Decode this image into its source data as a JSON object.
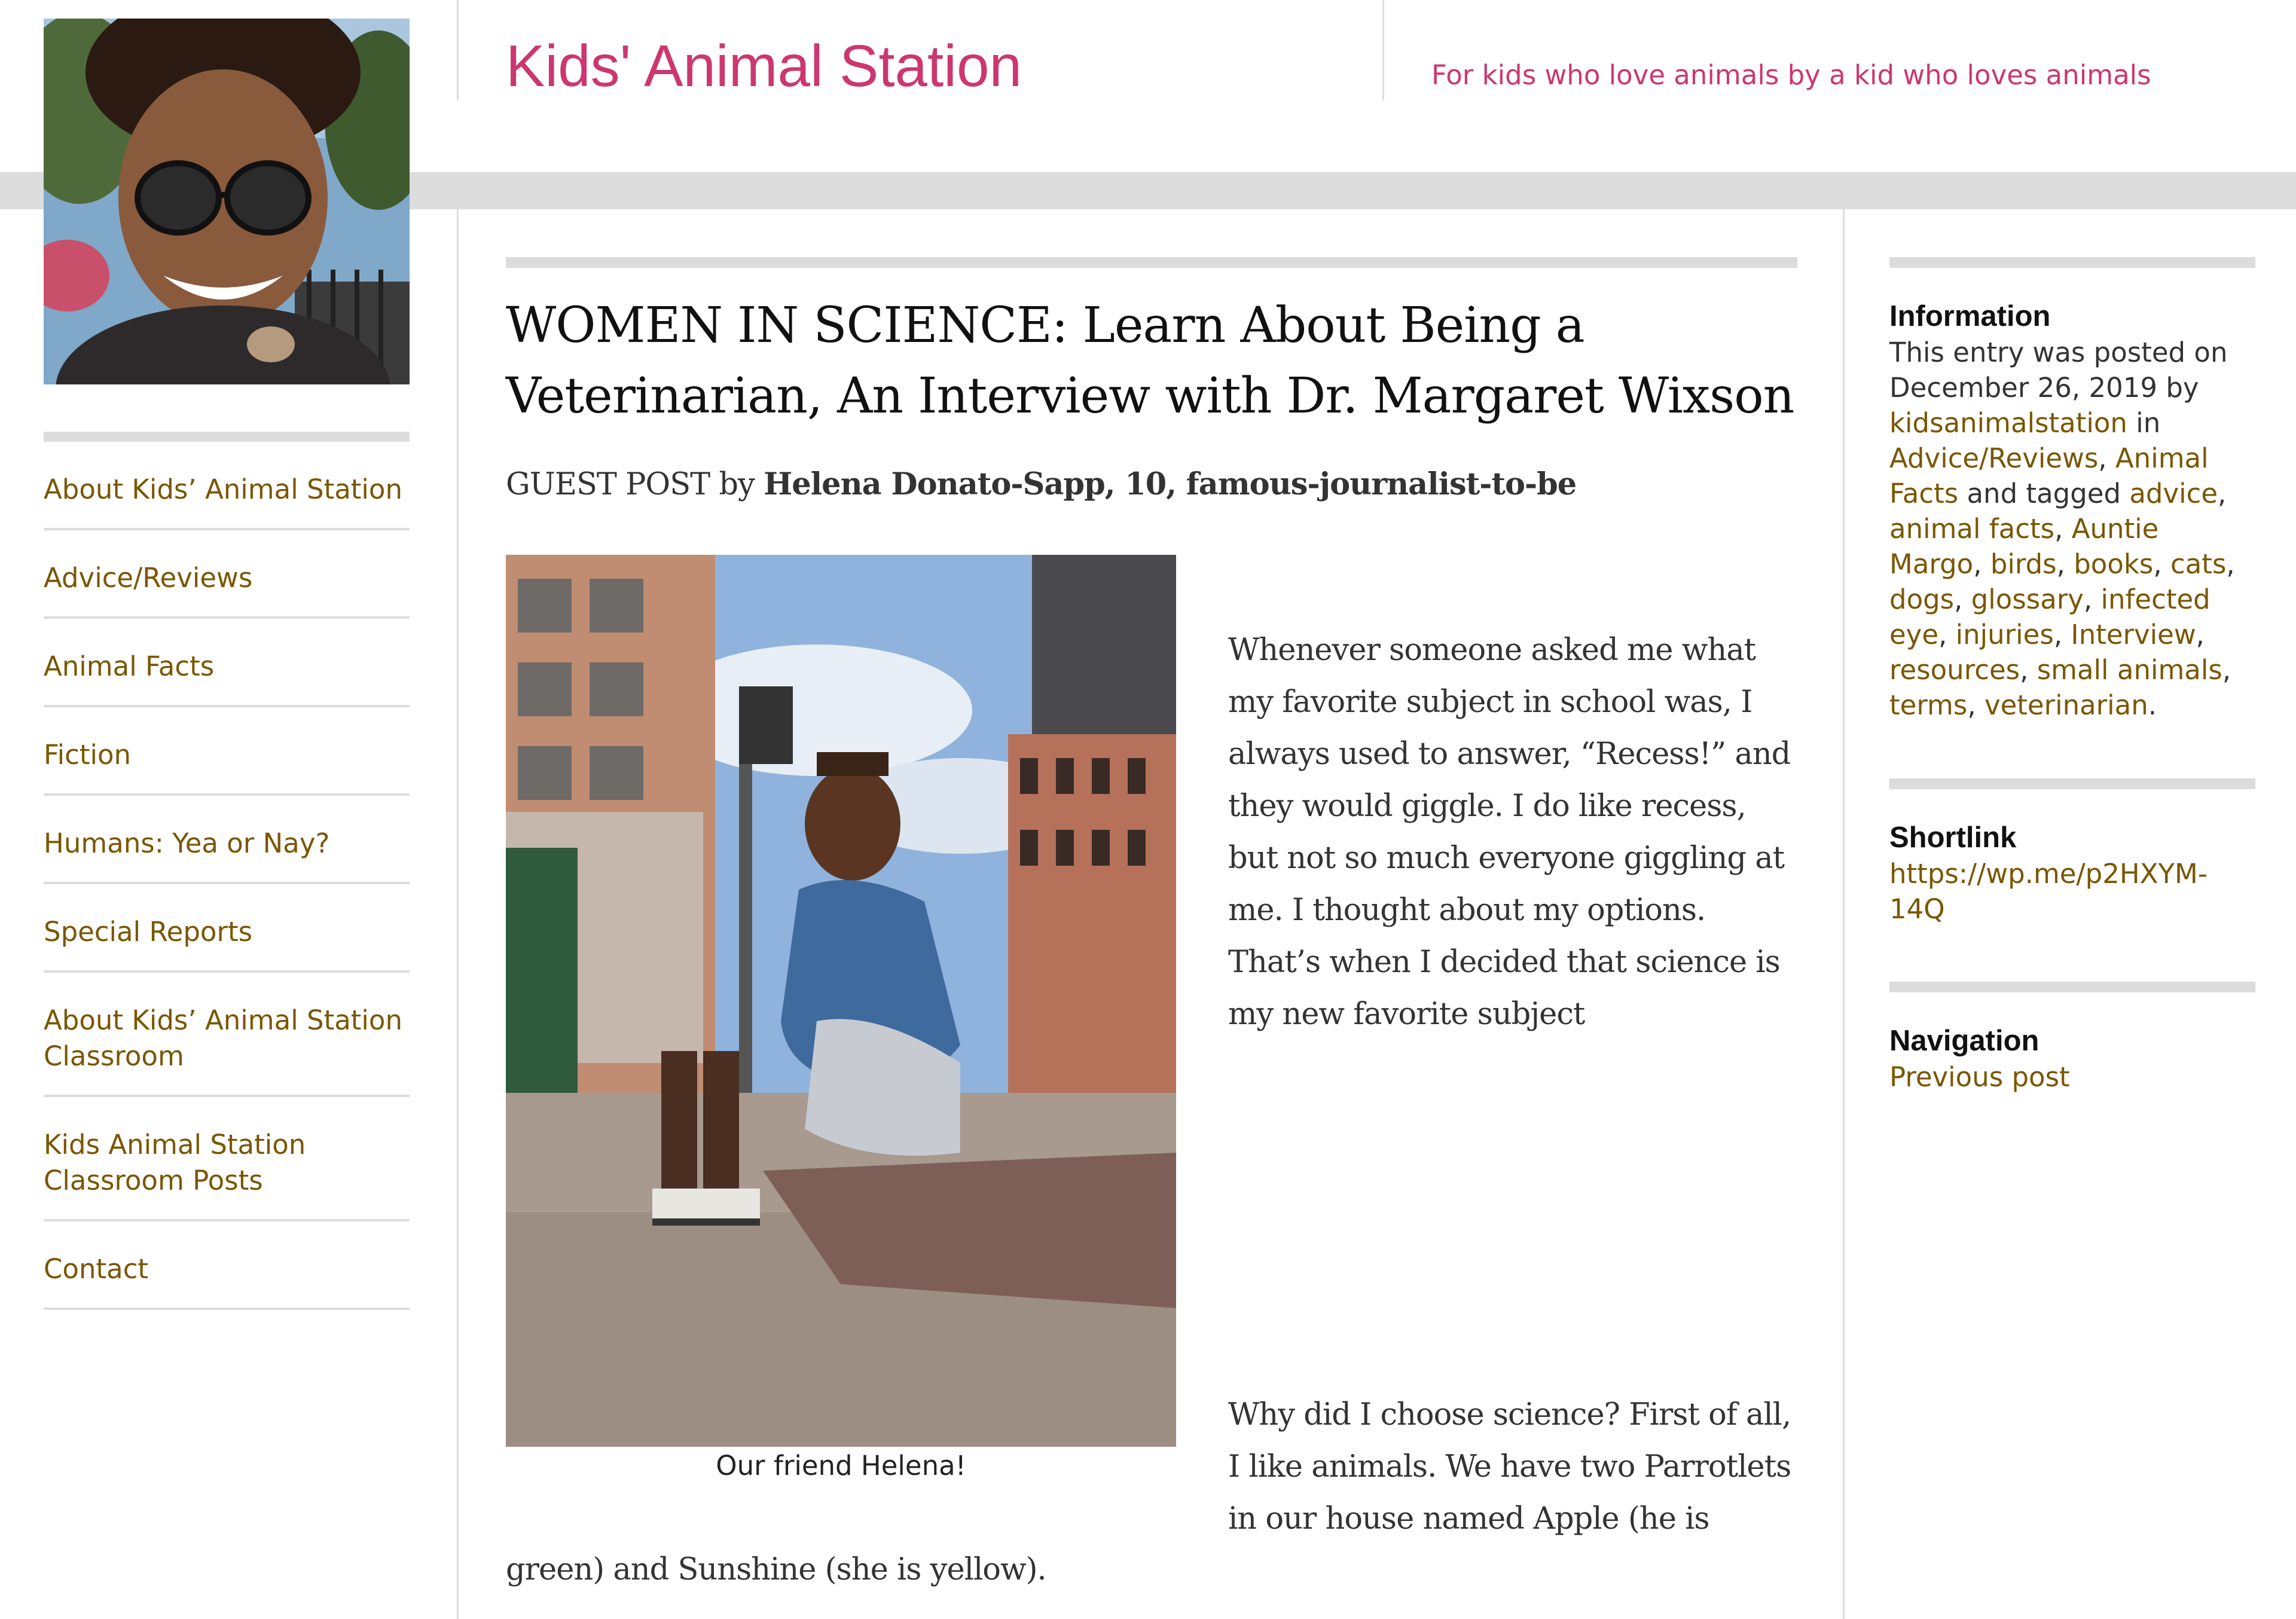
{
  "header": {
    "site_title": "Kids' Animal Station",
    "tagline": "For kids who love animals by a kid who loves animals"
  },
  "left_nav": {
    "items": [
      {
        "label": "About Kids’ Animal Station"
      },
      {
        "label": "Advice/Reviews"
      },
      {
        "label": "Animal Facts"
      },
      {
        "label": "Fiction"
      },
      {
        "label": "Humans: Yea or Nay?"
      },
      {
        "label": "Special Reports"
      },
      {
        "label": "About Kids’ Animal Station Classroom"
      },
      {
        "label": "Kids Animal Station Classroom Posts"
      },
      {
        "label": "Contact"
      }
    ]
  },
  "post": {
    "title": "WOMEN IN SCIENCE: Learn About Being a Veterinarian, An Interview with Dr. Margaret Wixson",
    "byline_prefix": "GUEST POST by ",
    "byline_author": "Helena Donato-Sapp, 10, famous-journalist-to-be",
    "image_caption": "Our friend Helena!",
    "paragraph1": "Whenever someone asked me what my favorite subject in school was, I always used to answer, “Recess!” and they would giggle.  I do like recess, but not so much everyone giggling at me.  I thought about my options.  That’s when I decided that science is my new favorite subject",
    "paragraph2_part1": "Why did I choose science?  First of all, I like animals.  We have two Parrotlets in our house named Apple (he is",
    "paragraph2_part2": "green) and Sunshine (she is yellow)."
  },
  "sidebar": {
    "information": {
      "title": "Information",
      "text_posted": "This entry was posted on December 26, 2019 by ",
      "author": "kidsanimalstation",
      "text_in": " in ",
      "categories": [
        "Advice/Reviews",
        "Animal Facts"
      ],
      "text_tagged": " and tagged ",
      "tags": [
        "advice",
        "animal facts",
        "Auntie Margo",
        "birds",
        "books",
        "cats",
        "dogs",
        "glossary",
        "infected eye",
        "injuries",
        "Interview",
        "resources",
        "small animals",
        "terms",
        "veterinarian"
      ],
      "comma": ", ",
      "period": "."
    },
    "shortlink": {
      "title": "Shortlink",
      "url": "https://wp.me/p2HXYM-14Q"
    },
    "navigation": {
      "title": "Navigation",
      "previous": "Previous post"
    }
  },
  "colors": {
    "brand_pink": "#cc3770",
    "link_brown": "#7a5600",
    "divider_gray": "#dcdcdc"
  }
}
